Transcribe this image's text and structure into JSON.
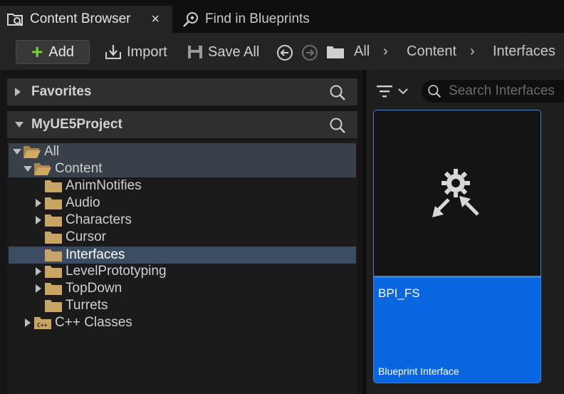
{
  "tabs": [
    {
      "label": "Content Browser",
      "icon": "content-browser-icon",
      "close": "×"
    },
    {
      "label": "Find in Blueprints",
      "icon": "find-blueprints-icon"
    }
  ],
  "toolbar": {
    "add_label": "Add",
    "import_label": "Import",
    "save_all_label": "Save All",
    "breadcrumb": [
      "All",
      "Content",
      "Interfaces"
    ],
    "separator": "›"
  },
  "sections": {
    "favorites": "Favorites",
    "project": "MyUE5Project"
  },
  "tree": [
    {
      "label": "All"
    },
    {
      "label": "Content"
    },
    {
      "label": "AnimNotifies"
    },
    {
      "label": "Audio"
    },
    {
      "label": "Characters"
    },
    {
      "label": "Cursor"
    },
    {
      "label": "Interfaces"
    },
    {
      "label": "LevelPrototyping"
    },
    {
      "label": "TopDown"
    },
    {
      "label": "Turrets"
    },
    {
      "label": "C++ Classes"
    }
  ],
  "search": {
    "placeholder": "Search Interfaces"
  },
  "asset": {
    "name": "BPI_FS",
    "type": "Blueprint Interface"
  },
  "colors": {
    "accent": "#0a66e0",
    "selection": "#3c4c62",
    "add_plus": "#7ad13a",
    "folder": "#c8a467"
  }
}
